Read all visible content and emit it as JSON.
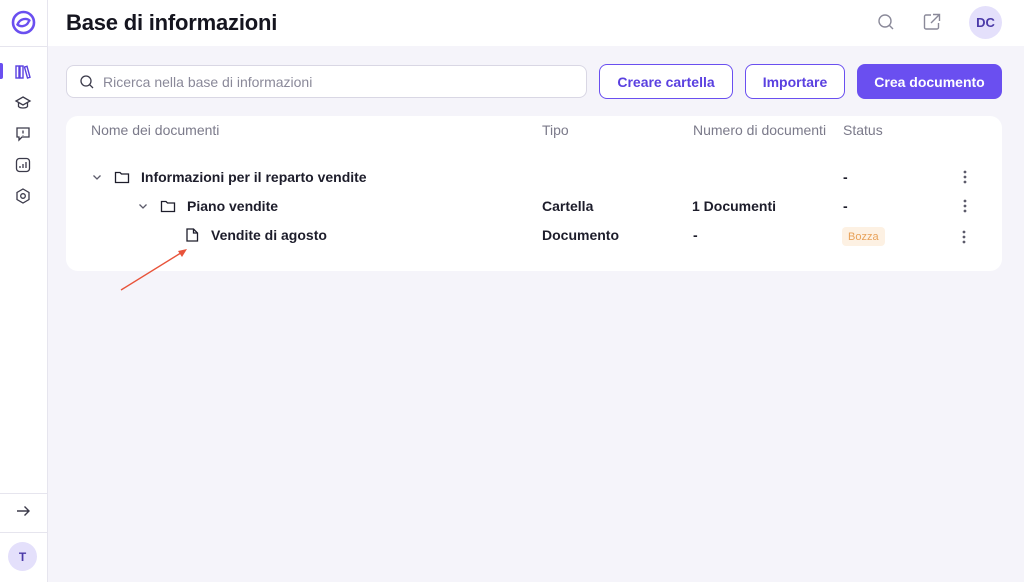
{
  "sidebar": {
    "logo_icon": "app-logo",
    "items": [
      {
        "icon": "knowledge-base-icon",
        "active": true
      },
      {
        "icon": "graduation-cap-icon",
        "active": false
      },
      {
        "icon": "chat-alert-icon",
        "active": false
      },
      {
        "icon": "analytics-icon",
        "active": false
      },
      {
        "icon": "settings-hex-icon",
        "active": false
      }
    ],
    "collapse_icon": "arrow-right-icon",
    "user_initial": "T"
  },
  "header": {
    "title": "Base di informazioni",
    "search_icon": "search-icon",
    "share_icon": "external-link-icon",
    "avatar_initials": "DC"
  },
  "toolbar": {
    "search_placeholder": "Ricerca nella base di informazioni",
    "create_folder_label": "Creare cartella",
    "import_label": "Importare",
    "create_document_label": "Crea documento"
  },
  "table": {
    "columns": [
      "Nome dei documenti",
      "Tipo",
      "Numero di documenti",
      "Status"
    ],
    "rows": [
      {
        "name": "Informazioni per il reparto vendite",
        "type": "",
        "count": "",
        "status": "-",
        "kind": "folder",
        "level": 0,
        "expanded": true
      },
      {
        "name": "Piano vendite",
        "type": "Cartella",
        "count": "1 Documenti",
        "status": "-",
        "kind": "folder",
        "level": 1,
        "expanded": true
      },
      {
        "name": "Vendite di agosto",
        "type": "Documento",
        "count": "-",
        "status": "Bozza",
        "kind": "document",
        "level": 2
      }
    ]
  },
  "colors": {
    "accent": "#6a4ff0",
    "draft_badge_bg": "#fdf1e3",
    "draft_badge_text": "#e8a25a",
    "annotation_arrow": "#e8533a"
  }
}
